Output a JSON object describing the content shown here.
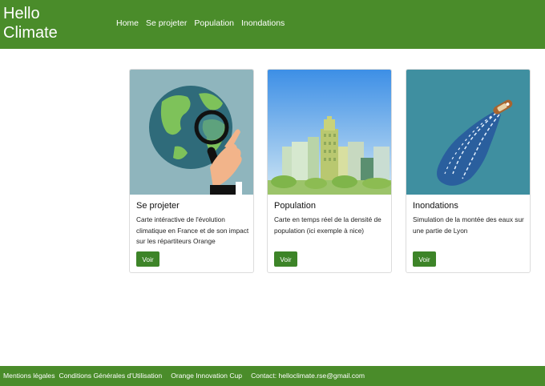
{
  "header": {
    "brand_line1": "Hello",
    "brand_line2": "Climate",
    "nav": [
      {
        "label": "Home"
      },
      {
        "label": "Se projeter"
      },
      {
        "label": "Population"
      },
      {
        "label": "Inondations"
      }
    ]
  },
  "cards": [
    {
      "title": "Se projeter",
      "text": "Carte intéractive de l'évolution climatique en France et de son impact sur les répartiteurs Orange",
      "button": "Voir",
      "image_icon": "globe-magnifier-illustration"
    },
    {
      "title": "Population",
      "text": "Carte en temps réel de la densité de population (ici exemple à nice)",
      "button": "Voir",
      "image_icon": "city-skyline-illustration"
    },
    {
      "title": "Inondations",
      "text": "Simulation de la montée des eaux sur une partie de Lyon",
      "button": "Voir",
      "image_icon": "boat-flood-illustration"
    }
  ],
  "footer": {
    "links": [
      {
        "label": "Mentions légales"
      },
      {
        "label": "Conditions Générales d'Utilisation"
      },
      {
        "label": "Orange Innovation Cup"
      },
      {
        "label": "Contact: helloclimate.rse@gmail.com"
      }
    ]
  },
  "colors": {
    "brand_green": "#4a8c2a",
    "button_green": "#3d8428"
  }
}
